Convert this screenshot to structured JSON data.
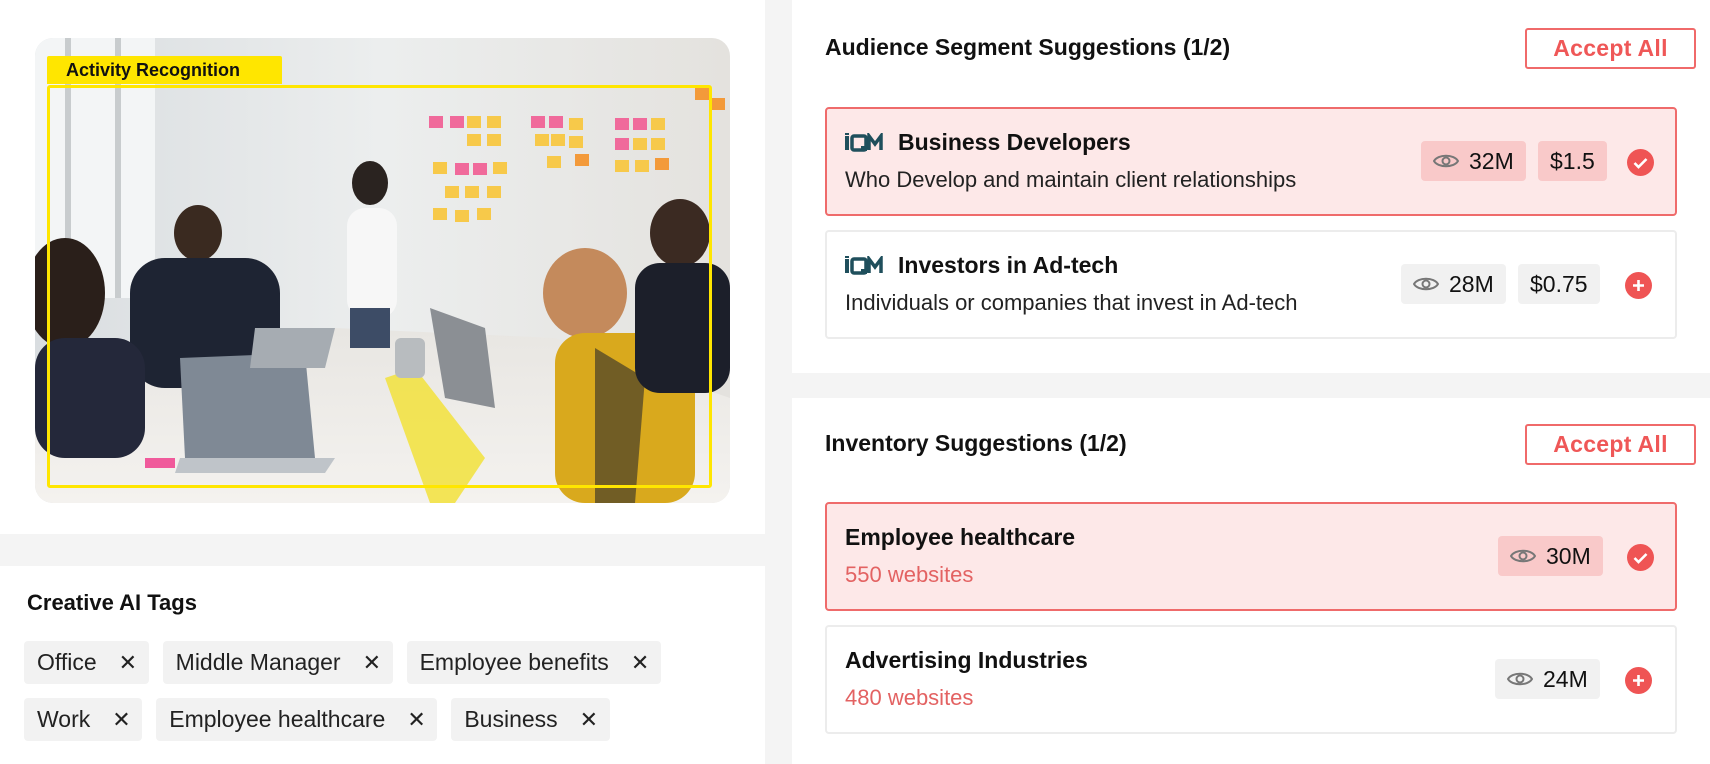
{
  "image_panel": {
    "detection_label": "Activity Recognition"
  },
  "tags_panel": {
    "title": "Creative AI Tags",
    "tags": [
      "Office",
      "Middle Manager",
      "Employee benefits",
      "Work",
      "Employee healthcare",
      "Business"
    ]
  },
  "audience": {
    "title": "Audience Segment Suggestions (1/2)",
    "accept_all": "Accept All",
    "items": [
      {
        "name": "Business Developers",
        "description": "Who Develop and maintain client relationships",
        "reach": "32M",
        "price": "$1.5",
        "status": "selected",
        "logo": "iqm-logo"
      },
      {
        "name": "Investors in Ad-tech",
        "description": "Individuals or companies that invest in Ad-tech",
        "reach": "28M",
        "price": "$0.75",
        "status": "add",
        "logo": "iqm-logo"
      }
    ]
  },
  "inventory": {
    "title": "Inventory Suggestions (1/2)",
    "accept_all": "Accept All",
    "items": [
      {
        "name": "Employee healthcare",
        "websites": "550 websites",
        "reach": "30M",
        "status": "selected"
      },
      {
        "name": "Advertising Industries",
        "websites": "480 websites",
        "reach": "24M",
        "status": "add"
      }
    ]
  },
  "colors": {
    "accent": "#ef5454",
    "selected_bg": "#fde8e8",
    "highlight": "#ffe600",
    "logo": "#1f4f5c"
  }
}
